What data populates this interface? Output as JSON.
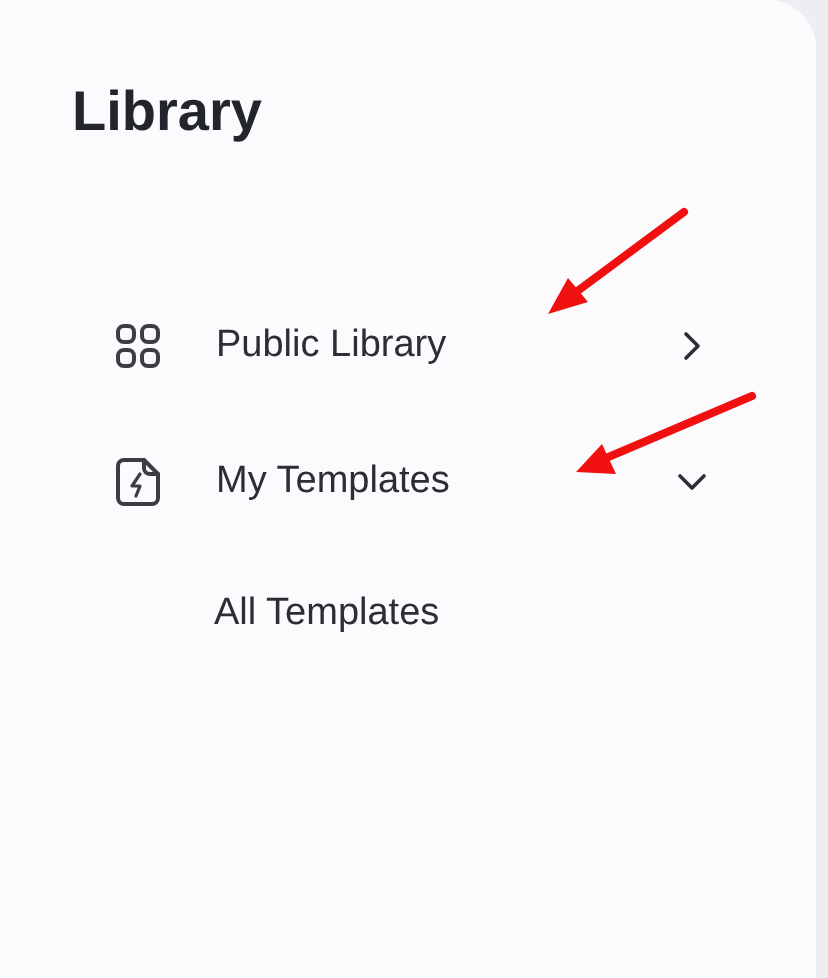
{
  "title": "Library",
  "items": [
    {
      "label": "Public Library",
      "expanded": false
    },
    {
      "label": "My Templates",
      "expanded": true,
      "children": [
        {
          "label": "All Templates"
        }
      ]
    }
  ],
  "annotations": [
    {
      "kind": "arrow"
    },
    {
      "kind": "arrow"
    }
  ]
}
